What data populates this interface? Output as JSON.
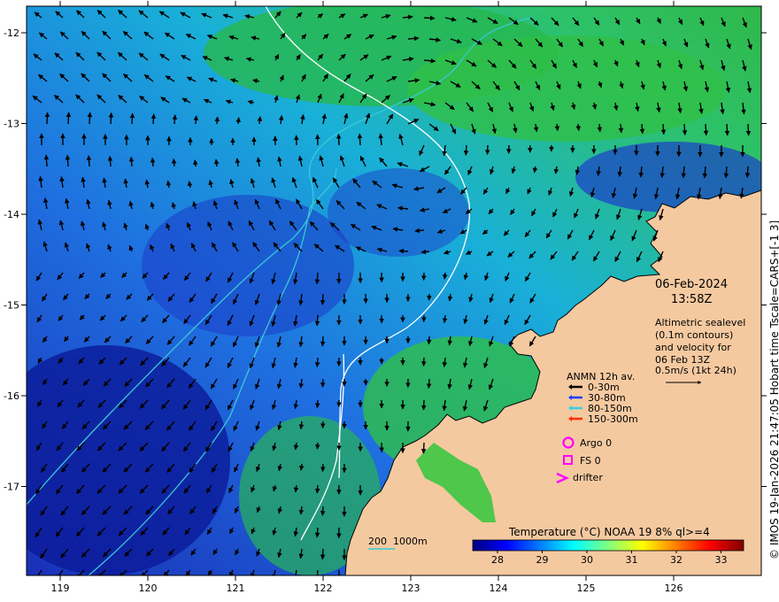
{
  "map": {
    "x_ticks": [
      "119",
      "120",
      "121",
      "122",
      "123",
      "124",
      "125",
      "126"
    ],
    "y_ticks": [
      "-12",
      "-13",
      "-14",
      "-15",
      "-16",
      "-17"
    ],
    "colors": {
      "land": "#f5c9a0",
      "arrow": "#000000",
      "contour": "#7fe0e8",
      "contour_white": "#ffffff",
      "depth_line": "#39c9d6"
    }
  },
  "info": {
    "date": "06-Feb-2024",
    "time": "13:58Z",
    "desc_lines": [
      "Altimetric sealevel",
      "(0.1m contours)",
      "and velocity for",
      "06 Feb 13Z",
      "0.5m/s (1kt 24h)"
    ]
  },
  "anmn": {
    "title": "ANMN 12h av.",
    "items": [
      {
        "label": "0-30m",
        "color": "#000000"
      },
      {
        "label": "30-80m",
        "color": "#1f3fff"
      },
      {
        "label": "80-150m",
        "color": "#36d1e6"
      },
      {
        "label": "150-300m",
        "color": "#ff2b00"
      }
    ]
  },
  "markers": {
    "argo": "Argo 0",
    "fs": "FS 0",
    "drifter": "drifter",
    "color": "#ff00ff"
  },
  "depth_legend": "200  1000m",
  "colorbar": {
    "title": "Temperature (°C) NOAA 19 8% ql>=4",
    "ticks": [
      "28",
      "29",
      "30",
      "31",
      "32",
      "33"
    ],
    "colors": [
      "#00007f",
      "#0000ff",
      "#007fff",
      "#00ffff",
      "#7fff7f",
      "#ffff00",
      "#ff7f00",
      "#ff0000",
      "#7f0000"
    ]
  },
  "copyright": "© IMOS 19-Jan-2026 21:47:05 Hobart time Tscale=CARS+[-1 3]"
}
